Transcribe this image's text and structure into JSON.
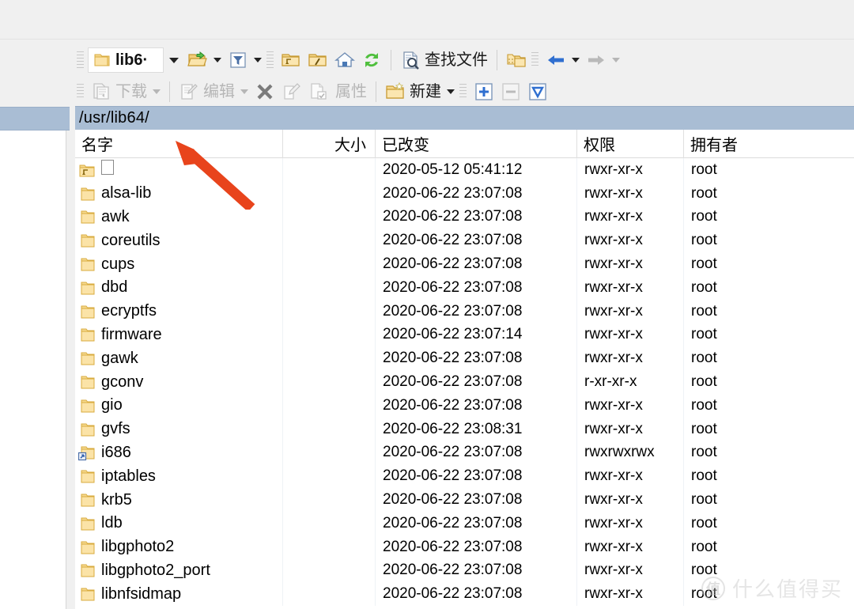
{
  "toolbar_top": {
    "folder_combo": {
      "icon": "folder-icon",
      "value": "lib6·",
      "dropdown": "chevron-down-icon"
    },
    "open_folder": {
      "icon": "open-folder-icon",
      "dropdown": "chevron-down-icon"
    },
    "filter": {
      "icon": "filter-icon",
      "dropdown": "chevron-down-icon"
    },
    "folder_up": {
      "icon": "folder-up-icon"
    },
    "folder_root": {
      "icon": "folder-root-icon"
    },
    "home": {
      "icon": "home-icon"
    },
    "refresh": {
      "icon": "refresh-icon"
    },
    "find_files": {
      "icon": "search-document-icon",
      "label": "查找文件"
    },
    "compare_folders": {
      "icon": "compare-folders-icon"
    },
    "back": {
      "icon": "arrow-left-icon",
      "dropdown": "chevron-down-icon"
    },
    "forward": {
      "icon": "arrow-right-icon",
      "dropdown": "chevron-down-icon"
    }
  },
  "toolbar_second": {
    "download": {
      "icon": "download-icon",
      "label": "下载",
      "dropdown": "chevron-down-icon",
      "disabled": true
    },
    "edit": {
      "icon": "edit-icon",
      "label": "编辑",
      "dropdown": "chevron-down-icon",
      "disabled": true
    },
    "delete": {
      "icon": "close-x-icon",
      "disabled": false
    },
    "rename": {
      "icon": "rename-icon",
      "disabled": true
    },
    "copy": {
      "icon": "copy-check-icon",
      "disabled": true
    },
    "properties": {
      "label": "属性",
      "disabled": true
    },
    "new": {
      "icon": "new-folder-icon",
      "label": "新建",
      "dropdown": "chevron-down-icon"
    },
    "select_add": {
      "icon": "plus-box-icon"
    },
    "select_remove": {
      "icon": "minus-box-icon",
      "disabled": true
    },
    "select_invert": {
      "icon": "invert-selection-icon"
    }
  },
  "path_bar": {
    "path": "/usr/lib64/"
  },
  "columns": [
    {
      "key": "name",
      "label": "名字"
    },
    {
      "key": "size",
      "label": "大小"
    },
    {
      "key": "changed",
      "label": "已改变"
    },
    {
      "key": "perms",
      "label": "权限"
    },
    {
      "key": "owner",
      "label": "拥有者"
    }
  ],
  "rows": [
    {
      "name": "..",
      "icon": "folder-up-icon",
      "size": "",
      "changed": "2020-05-12 05:41:12",
      "perms": "rwxr-xr-x",
      "owner": "root"
    },
    {
      "name": "alsa-lib",
      "icon": "folder-icon",
      "size": "",
      "changed": "2020-06-22 23:07:08",
      "perms": "rwxr-xr-x",
      "owner": "root"
    },
    {
      "name": "awk",
      "icon": "folder-icon",
      "size": "",
      "changed": "2020-06-22 23:07:08",
      "perms": "rwxr-xr-x",
      "owner": "root"
    },
    {
      "name": "coreutils",
      "icon": "folder-icon",
      "size": "",
      "changed": "2020-06-22 23:07:08",
      "perms": "rwxr-xr-x",
      "owner": "root"
    },
    {
      "name": "cups",
      "icon": "folder-icon",
      "size": "",
      "changed": "2020-06-22 23:07:08",
      "perms": "rwxr-xr-x",
      "owner": "root"
    },
    {
      "name": "dbd",
      "icon": "folder-icon",
      "size": "",
      "changed": "2020-06-22 23:07:08",
      "perms": "rwxr-xr-x",
      "owner": "root"
    },
    {
      "name": "ecryptfs",
      "icon": "folder-icon",
      "size": "",
      "changed": "2020-06-22 23:07:08",
      "perms": "rwxr-xr-x",
      "owner": "root"
    },
    {
      "name": "firmware",
      "icon": "folder-icon",
      "size": "",
      "changed": "2020-06-22 23:07:14",
      "perms": "rwxr-xr-x",
      "owner": "root"
    },
    {
      "name": "gawk",
      "icon": "folder-icon",
      "size": "",
      "changed": "2020-06-22 23:07:08",
      "perms": "rwxr-xr-x",
      "owner": "root"
    },
    {
      "name": "gconv",
      "icon": "folder-icon",
      "size": "",
      "changed": "2020-06-22 23:07:08",
      "perms": "r-xr-xr-x",
      "owner": "root"
    },
    {
      "name": "gio",
      "icon": "folder-icon",
      "size": "",
      "changed": "2020-06-22 23:07:08",
      "perms": "rwxr-xr-x",
      "owner": "root"
    },
    {
      "name": "gvfs",
      "icon": "folder-icon",
      "size": "",
      "changed": "2020-06-22 23:08:31",
      "perms": "rwxr-xr-x",
      "owner": "root"
    },
    {
      "name": "i686",
      "icon": "folder-symlink-icon",
      "size": "",
      "changed": "2020-06-22 23:07:08",
      "perms": "rwxrwxrwx",
      "owner": "root"
    },
    {
      "name": "iptables",
      "icon": "folder-icon",
      "size": "",
      "changed": "2020-06-22 23:07:08",
      "perms": "rwxr-xr-x",
      "owner": "root"
    },
    {
      "name": "krb5",
      "icon": "folder-icon",
      "size": "",
      "changed": "2020-06-22 23:07:08",
      "perms": "rwxr-xr-x",
      "owner": "root"
    },
    {
      "name": "ldb",
      "icon": "folder-icon",
      "size": "",
      "changed": "2020-06-22 23:07:08",
      "perms": "rwxr-xr-x",
      "owner": "root"
    },
    {
      "name": "libgphoto2",
      "icon": "folder-icon",
      "size": "",
      "changed": "2020-06-22 23:07:08",
      "perms": "rwxr-xr-x",
      "owner": "root"
    },
    {
      "name": "libgphoto2_port",
      "icon": "folder-icon",
      "size": "",
      "changed": "2020-06-22 23:07:08",
      "perms": "rwxr-xr-x",
      "owner": "root"
    },
    {
      "name": "libnfsidmap",
      "icon": "folder-icon",
      "size": "",
      "changed": "2020-06-22 23:07:08",
      "perms": "rwxr-xr-x",
      "owner": "root"
    }
  ],
  "annotation": {
    "type": "arrow",
    "color": "#e8441c",
    "points_to": "name-column-header"
  },
  "watermark": {
    "logo_char": "值",
    "text": "什么值得买"
  },
  "colors": {
    "path_bar_bg": "#a9bdd4",
    "toolbar_bg": "#f0f0f0",
    "folder_yellow": "#f2c14b",
    "accent_arrow": "#e8441c"
  }
}
